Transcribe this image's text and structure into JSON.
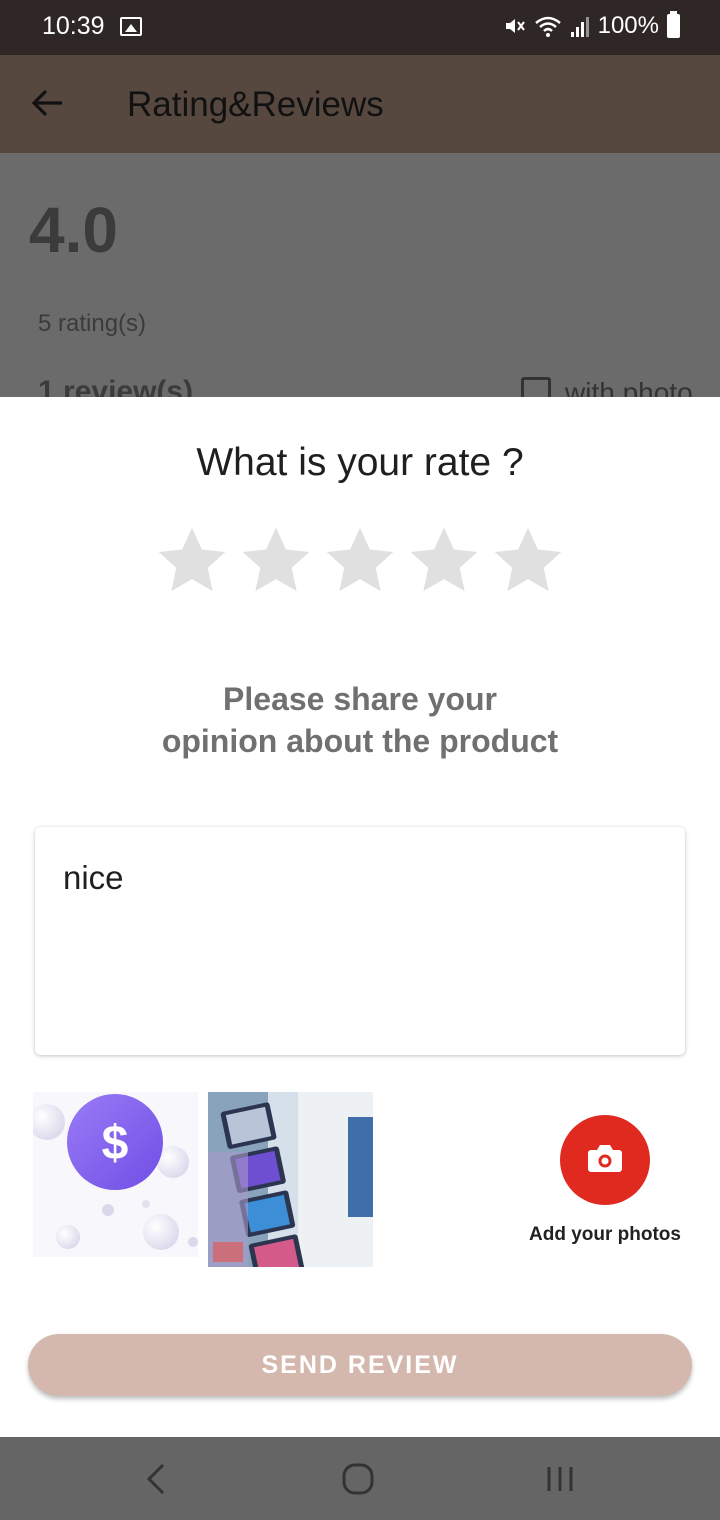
{
  "status_bar": {
    "time": "10:39",
    "battery": "100%",
    "icons": [
      "image-icon",
      "mute-icon",
      "wifi-icon",
      "signal-icon",
      "battery-icon"
    ]
  },
  "app_bar": {
    "title": "Rating&Reviews",
    "back_icon": "back-arrow-icon"
  },
  "background": {
    "rating_value": "4.0",
    "rating_count": "5 rating(s)",
    "review_count": "1 review(s)",
    "with_photo_label": "with photo"
  },
  "sheet": {
    "title": "What is your rate ?",
    "stars_total": 5,
    "stars_selected": 0,
    "prompt_line1": "Please share your",
    "prompt_line2": "opinion about the product",
    "review_value": "nice",
    "add_photos_label": "Add your photos",
    "send_label": "SEND REVIEW"
  },
  "colors": {
    "status_bar": "#2e2725",
    "app_bar_dimmed": "#56483f",
    "star_inactive": "#e0e0e0",
    "camera_button": "#e0291f",
    "send_button": "#d4b8ae",
    "nav_bar": "#656565"
  },
  "nav_bar": {
    "icons": [
      "back-nav-icon",
      "home-nav-icon",
      "recents-nav-icon"
    ]
  }
}
